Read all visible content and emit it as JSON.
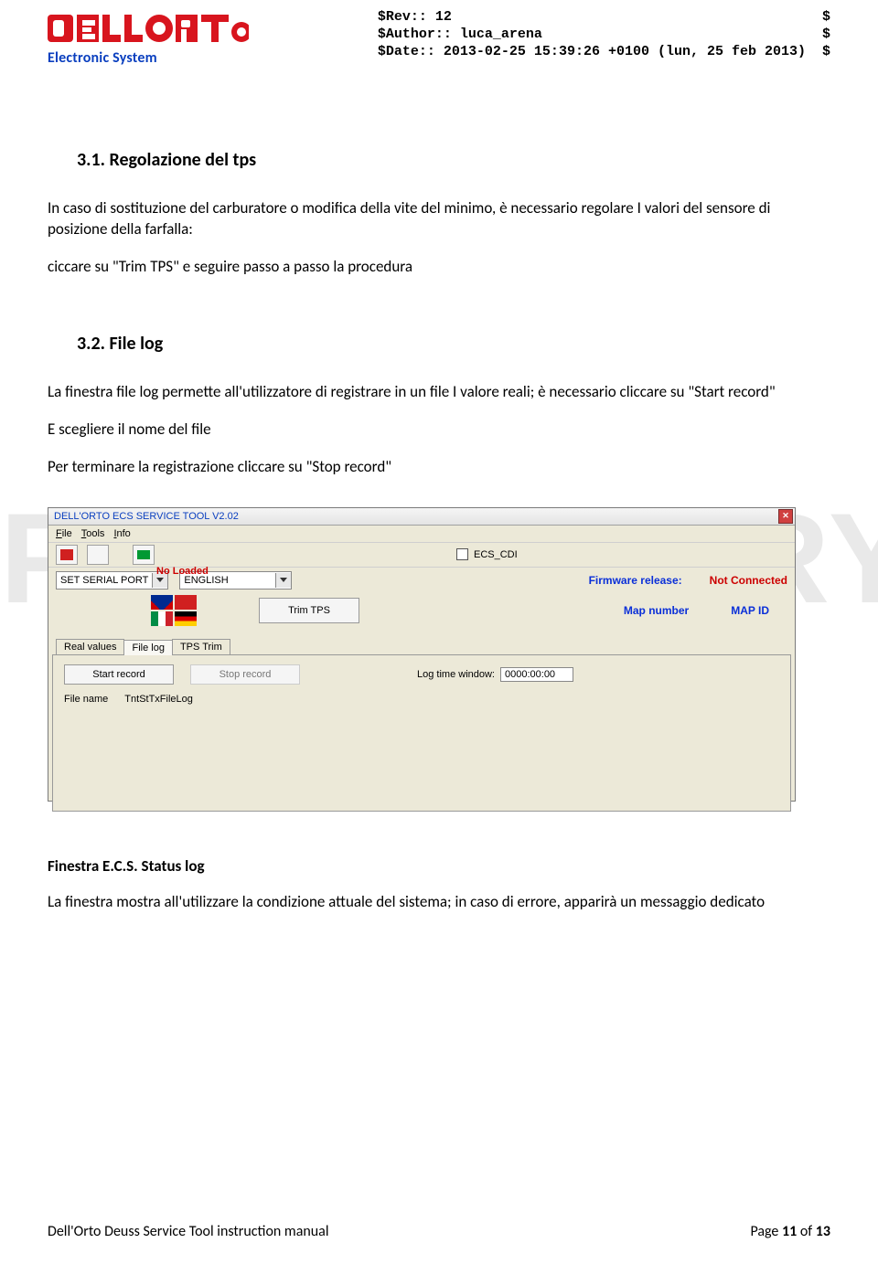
{
  "header": {
    "brand_sub": "Electronic System",
    "meta_rev": "$Rev:: 12                                             $",
    "meta_author": "$Author:: luca_arena                                  $",
    "meta_date": "$Date:: 2013-02-25 15:39:26 +0100 (lun, 25 feb 2013)  $"
  },
  "watermark": "PRELIMINARY",
  "section1": {
    "heading": "3.1.    Regolazione del tps",
    "p1": "In caso di sostituzione del carburatore o modifica della vite del minimo, è necessario regolare I valori del sensore di posizione della farfalla:",
    "p2": "ciccare su  \"Trim TPS\" e seguire passo a passo la procedura"
  },
  "section2": {
    "heading": "3.2.    File log",
    "p1": "La finestra  file log  permette all'utilizzatore di registrare in un file I valore reali; è necessario cliccare su  \"Start record\"",
    "p2": "E scegliere il nome del file",
    "p3": "Per terminare la registrazione cliccare su  \"Stop record\""
  },
  "screenshot": {
    "title": "DELL'ORTO ECS SERVICE TOOL  V2.02",
    "menu": {
      "file": "File",
      "tools": "Tools",
      "info": "Info",
      "file_u": "F",
      "tools_u": "T",
      "info_u": "I"
    },
    "ecs_label": "ECS_CDI",
    "no_loaded": "No Loaded",
    "serial_port": "SET SERIAL PORT",
    "language": "ENGLISH",
    "trim_tps": "Trim TPS",
    "fw_release_label": "Firmware release:",
    "fw_release_value": "Not Connected",
    "map_number_label": "Map number",
    "map_id_label": "MAP ID",
    "tabs": {
      "real": "Real values",
      "filelog": "File log",
      "tpstrim": "TPS Trim"
    },
    "start_record": "Start record",
    "stop_record": "Stop record",
    "log_time_label": "Log time window:",
    "log_time_value": "0000:00:00",
    "file_name_label": "File name",
    "file_name_value": "TntStTxFileLog"
  },
  "section3": {
    "caption": "Finestra E.C.S. Status log",
    "p1": "La finestra mostra all'utilizzare la condizione attuale del sistema; in caso di errore, apparirà un messaggio dedicato"
  },
  "footer": {
    "left": "Dell'Orto   Deuss Service Tool  instruction  manual",
    "right_prefix": "Page ",
    "right_page": "11",
    "right_mid": " of ",
    "right_total": "13"
  }
}
